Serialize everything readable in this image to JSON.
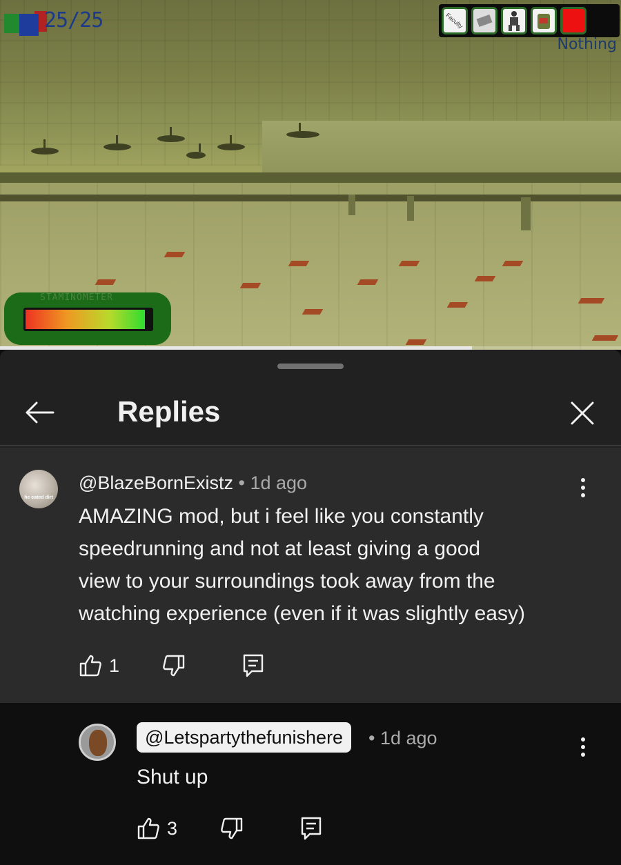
{
  "video": {
    "health_text": "25/25",
    "inventory_slot_label": "Nothing",
    "inventory_first_item_text": "Faculty",
    "stamina_label": "STAMINOMETER",
    "stamina_level": 0.95,
    "playback_progress": 0.76
  },
  "sheet": {
    "title": "Replies"
  },
  "comment": {
    "author": "@BlazeBornExistz",
    "separator": "•",
    "time": "1d ago",
    "avatar_caption": "he eated dirt",
    "text_lines": [
      "AMAZING mod, but i feel like you constantly",
      "speedrunning and not at least giving a good",
      "view to your surroundings took away from the",
      "watching experience (even if it was slightly easy)"
    ],
    "likes": "1"
  },
  "reply": {
    "author": "@Letspartythefunishere",
    "separator": "•",
    "time": "1d ago",
    "text": "Shut up",
    "likes": "3"
  },
  "colors": {
    "sheet_bg": "#212121",
    "parent_bg": "#2b2b2b",
    "reply_bg": "#0f0f0f",
    "text_primary": "#f1f1f1",
    "text_secondary": "#aaaaaa"
  }
}
